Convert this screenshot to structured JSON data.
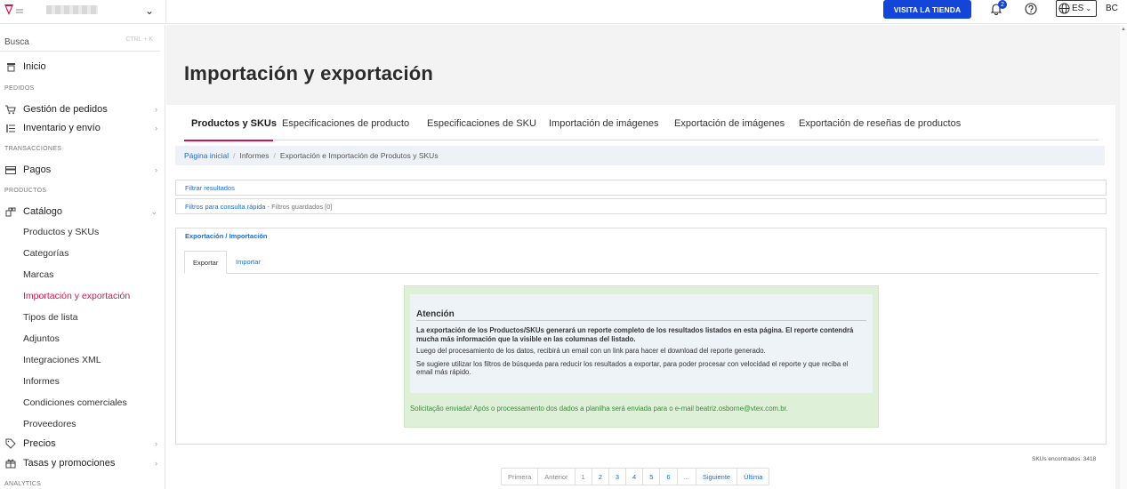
{
  "topbar": {
    "account_chevron": "⌄",
    "visit_store": "VISITA LA TIENDA",
    "notification_count": "2",
    "language": "ES",
    "language_chevron": "⌄",
    "avatar_initials": "BC",
    "accent_color": "#1345d9"
  },
  "sidebar": {
    "search_placeholder": "Busca",
    "search_shortcut": "CTRL + K",
    "home": "Inicio",
    "sections": {
      "orders": "PEDIDOS",
      "transactions": "TRANSACCIONES",
      "products": "PRODUCTOS",
      "analytics": "ANALYTICS"
    },
    "items": {
      "orders_mgmt": "Gestión de pedidos",
      "inventory": "Inventario y envío",
      "payments": "Pagos",
      "catalog": "Catálogo",
      "prices": "Precios",
      "promotions": "Tasas y promociones"
    },
    "catalog_sub": [
      "Productos y SKUs",
      "Categorías",
      "Marcas",
      "Importación y exportación",
      "Tipos de lista",
      "Adjuntos",
      "Integraciones XML",
      "Informes",
      "Condiciones comerciales",
      "Proveedores"
    ],
    "active_color": "#d1144e"
  },
  "main": {
    "title": "Importación y exportación",
    "tabs": [
      "Productos y SKUs",
      "Especificaciones de producto",
      "Especificaciones de SKU",
      "Importación de imágenes",
      "Exportación de imágenes",
      "Exportación de reseñas de productos"
    ],
    "breadcrumb": {
      "home": "Página inicial",
      "sep": "/",
      "reports": "Informes",
      "current": "Exportación e Importación de Produtos y SKUs"
    },
    "filter_results": "Filtrar resultados",
    "quick_filters": "Filtros para consulta rápida",
    "saved_filters": " - Filtros guardados [0]",
    "export_import_header": "Exportación / Importación",
    "export_tab": "Exportar",
    "import_tab": "Importar",
    "alert": {
      "title": "Atención",
      "p1": "La exportación de los Productos/SKUs generará un reporte completo de los resultados listados en esta página. El reporte contendrá mucha más información que la visible en las columnas del listado.",
      "p2": "Luego del procesamiento de los datos, recibirá un email con un link para hacer el download del reporte generado.",
      "p3": "Se sugiere utilizar los filtros de búsqueda para reducir los resultados a exportar, para poder procesar con velocidad el reporte y que reciba el email más rápido.",
      "success": "Solicitação enviada! Após o processamento dos dados a planilha será enviada para o e-mail beatriz.osborne@vtex.com.br."
    },
    "skus_found": "SKUs encontrados: 3418",
    "pager": [
      "Primera",
      "Anterior",
      "1",
      "2",
      "3",
      "4",
      "5",
      "6",
      "...",
      "Siguiente",
      "Última"
    ]
  }
}
